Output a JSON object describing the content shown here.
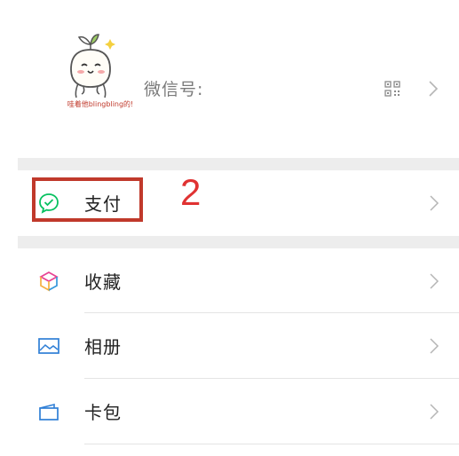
{
  "profile": {
    "avatar_caption": "哇着他blingbling的!",
    "wechat_id_label": "微信号:",
    "qr_icon": "qr-code-icon",
    "chevron_icon": "chevron-right-icon"
  },
  "menu": {
    "pay": {
      "label": "支付",
      "icon": "wechat-pay-icon",
      "icon_color": "#07c160"
    },
    "favorites": {
      "label": "收藏",
      "icon": "cube-icon"
    },
    "album": {
      "label": "相册",
      "icon": "picture-icon",
      "icon_color": "#2f7fd6"
    },
    "cards": {
      "label": "卡包",
      "icon": "wallet-icon",
      "icon_color": "#2f7fd6"
    }
  },
  "annotation": {
    "number": "2",
    "color": "#e03232",
    "box_color": "#c0392b"
  }
}
